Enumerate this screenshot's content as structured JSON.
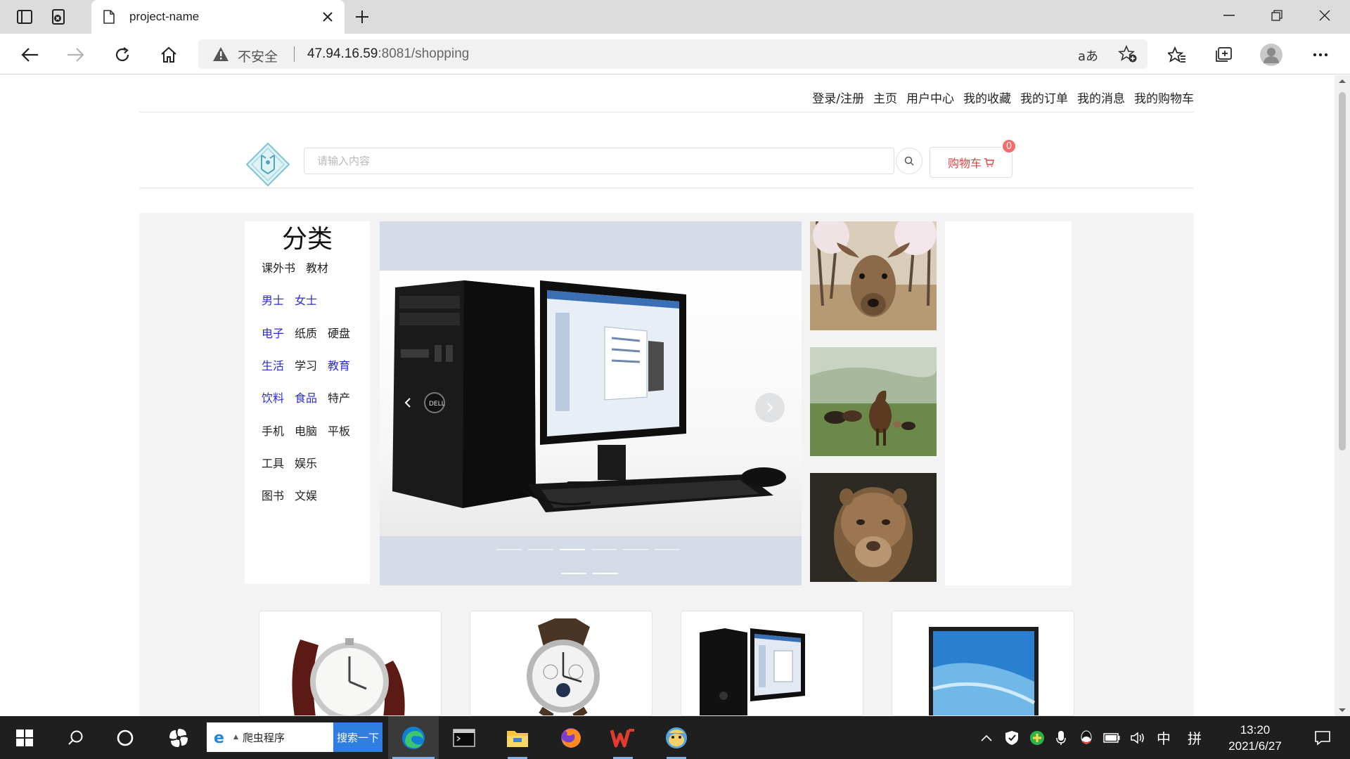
{
  "browser": {
    "tab_title": "project-name",
    "insecure_label": "不安全",
    "url_host": "47.94.16.59",
    "url_rest": ":8081/shopping",
    "read_aloud_label": "aあ"
  },
  "site": {
    "top_nav": [
      "登录/注册",
      "主页",
      "用户中心",
      "我的收藏",
      "我的订单",
      "我的消息",
      "我的购物车"
    ],
    "search_placeholder": "请输入内容",
    "cart_label": "购物车",
    "cart_count": "0",
    "category_title": "分类",
    "categories": [
      [
        {
          "label": "课外书",
          "color": "dark"
        },
        {
          "label": "教材",
          "color": "dark"
        }
      ],
      [
        {
          "label": "男士",
          "color": "blue"
        },
        {
          "label": "女士",
          "color": "blue"
        }
      ],
      [
        {
          "label": "电子",
          "color": "blue"
        },
        {
          "label": "纸质",
          "color": "dark"
        },
        {
          "label": "硬盘",
          "color": "dark"
        }
      ],
      [
        {
          "label": "生活",
          "color": "blue"
        },
        {
          "label": "学习",
          "color": "dark"
        },
        {
          "label": "教育",
          "color": "blue"
        }
      ],
      [
        {
          "label": "饮料",
          "color": "blue"
        },
        {
          "label": "食品",
          "color": "blue"
        },
        {
          "label": "特产",
          "color": "dark"
        }
      ],
      [
        {
          "label": "手机",
          "color": "dark"
        },
        {
          "label": "电脑",
          "color": "dark"
        },
        {
          "label": "平板",
          "color": "dark"
        }
      ],
      [
        {
          "label": "工具",
          "color": "dark"
        },
        {
          "label": "娱乐",
          "color": "dark"
        }
      ],
      [
        {
          "label": "图书",
          "color": "dark"
        },
        {
          "label": "文娱",
          "color": "dark"
        }
      ]
    ],
    "carousel_active_index": 2,
    "carousel_indicator_count": 6,
    "side_images": [
      "deer-photo",
      "horses-photo",
      "lioness-photo"
    ],
    "products": [
      "leather-watch",
      "chronograph-watch",
      "desktop-computer",
      "laptop-monitor"
    ]
  },
  "taskbar": {
    "search_text": "爬虫程序",
    "search_button": "搜索一下",
    "ime_lang": "中",
    "ime_mode": "拼",
    "time": "13:20",
    "date": "2021/6/27"
  },
  "colors": {
    "accent_blue": "#2b2bd6",
    "cart_red": "#e64242",
    "badge_red": "#f56c6c",
    "taskbar": "#1f1f1f"
  }
}
